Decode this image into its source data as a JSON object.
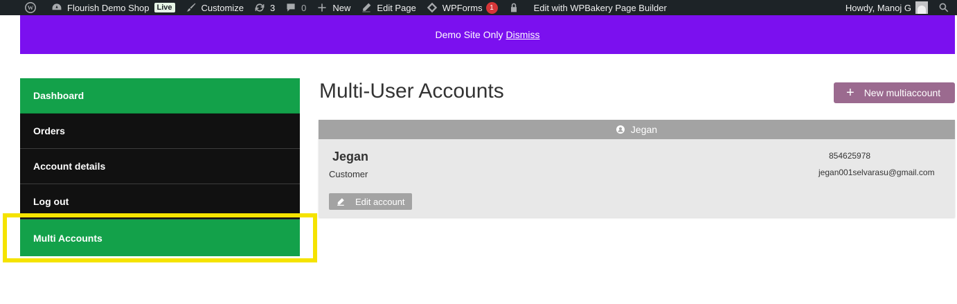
{
  "adminbar": {
    "site_name": "Flourish Demo Shop",
    "live_badge": "Live",
    "customize": "Customize",
    "updates_count": "3",
    "comments_count": "0",
    "new": "New",
    "edit_page": "Edit Page",
    "wpforms": "WPForms",
    "wpforms_count": "1",
    "wpbakery": "Edit with WPBakery Page Builder",
    "howdy": "Howdy, Manoj G"
  },
  "banner": {
    "text": "Demo Site Only",
    "dismiss": "Dismiss"
  },
  "nav": {
    "items": [
      {
        "label": "Dashboard",
        "style": "green"
      },
      {
        "label": "Orders",
        "style": "dark"
      },
      {
        "label": "Account details",
        "style": "dark"
      },
      {
        "label": "Log out",
        "style": "dark"
      },
      {
        "label": "Multi Accounts",
        "style": "green"
      }
    ]
  },
  "main": {
    "title": "Multi-User Accounts",
    "new_button": "New multiaccount",
    "account": {
      "header_name": "Jegan",
      "name": "Jegan",
      "role": "Customer",
      "phone": "854625978",
      "email": "jegan001selvarasu@gmail.com",
      "edit_button": "Edit account"
    }
  },
  "colors": {
    "admin_bar": "#1d2327",
    "banner": "#7b10ef",
    "nav_green": "#13a14a",
    "nav_dark": "#111111",
    "new_button": "#9b6a8f",
    "highlight": "#f5e300"
  }
}
